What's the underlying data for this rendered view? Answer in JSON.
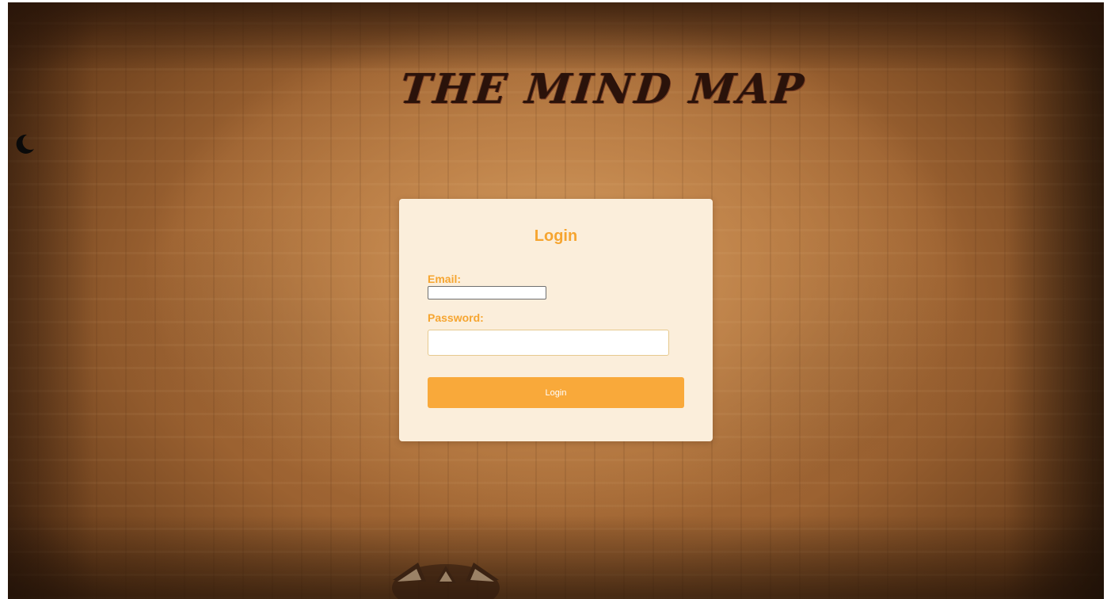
{
  "header": {
    "title": "THE MIND MAP"
  },
  "theme_toggle": {
    "icon": "moon-icon"
  },
  "login_form": {
    "title": "Login",
    "email_label": "Email:",
    "email_value": "",
    "password_label": "Password:",
    "password_value": "",
    "submit_label": "Login"
  },
  "decoration": {
    "icon": "jack-o-lantern-icon"
  },
  "colors": {
    "accent": "#f6a530",
    "button": "#f9a93a",
    "card_background": "#fbeedb",
    "title_text": "#2a120a"
  }
}
